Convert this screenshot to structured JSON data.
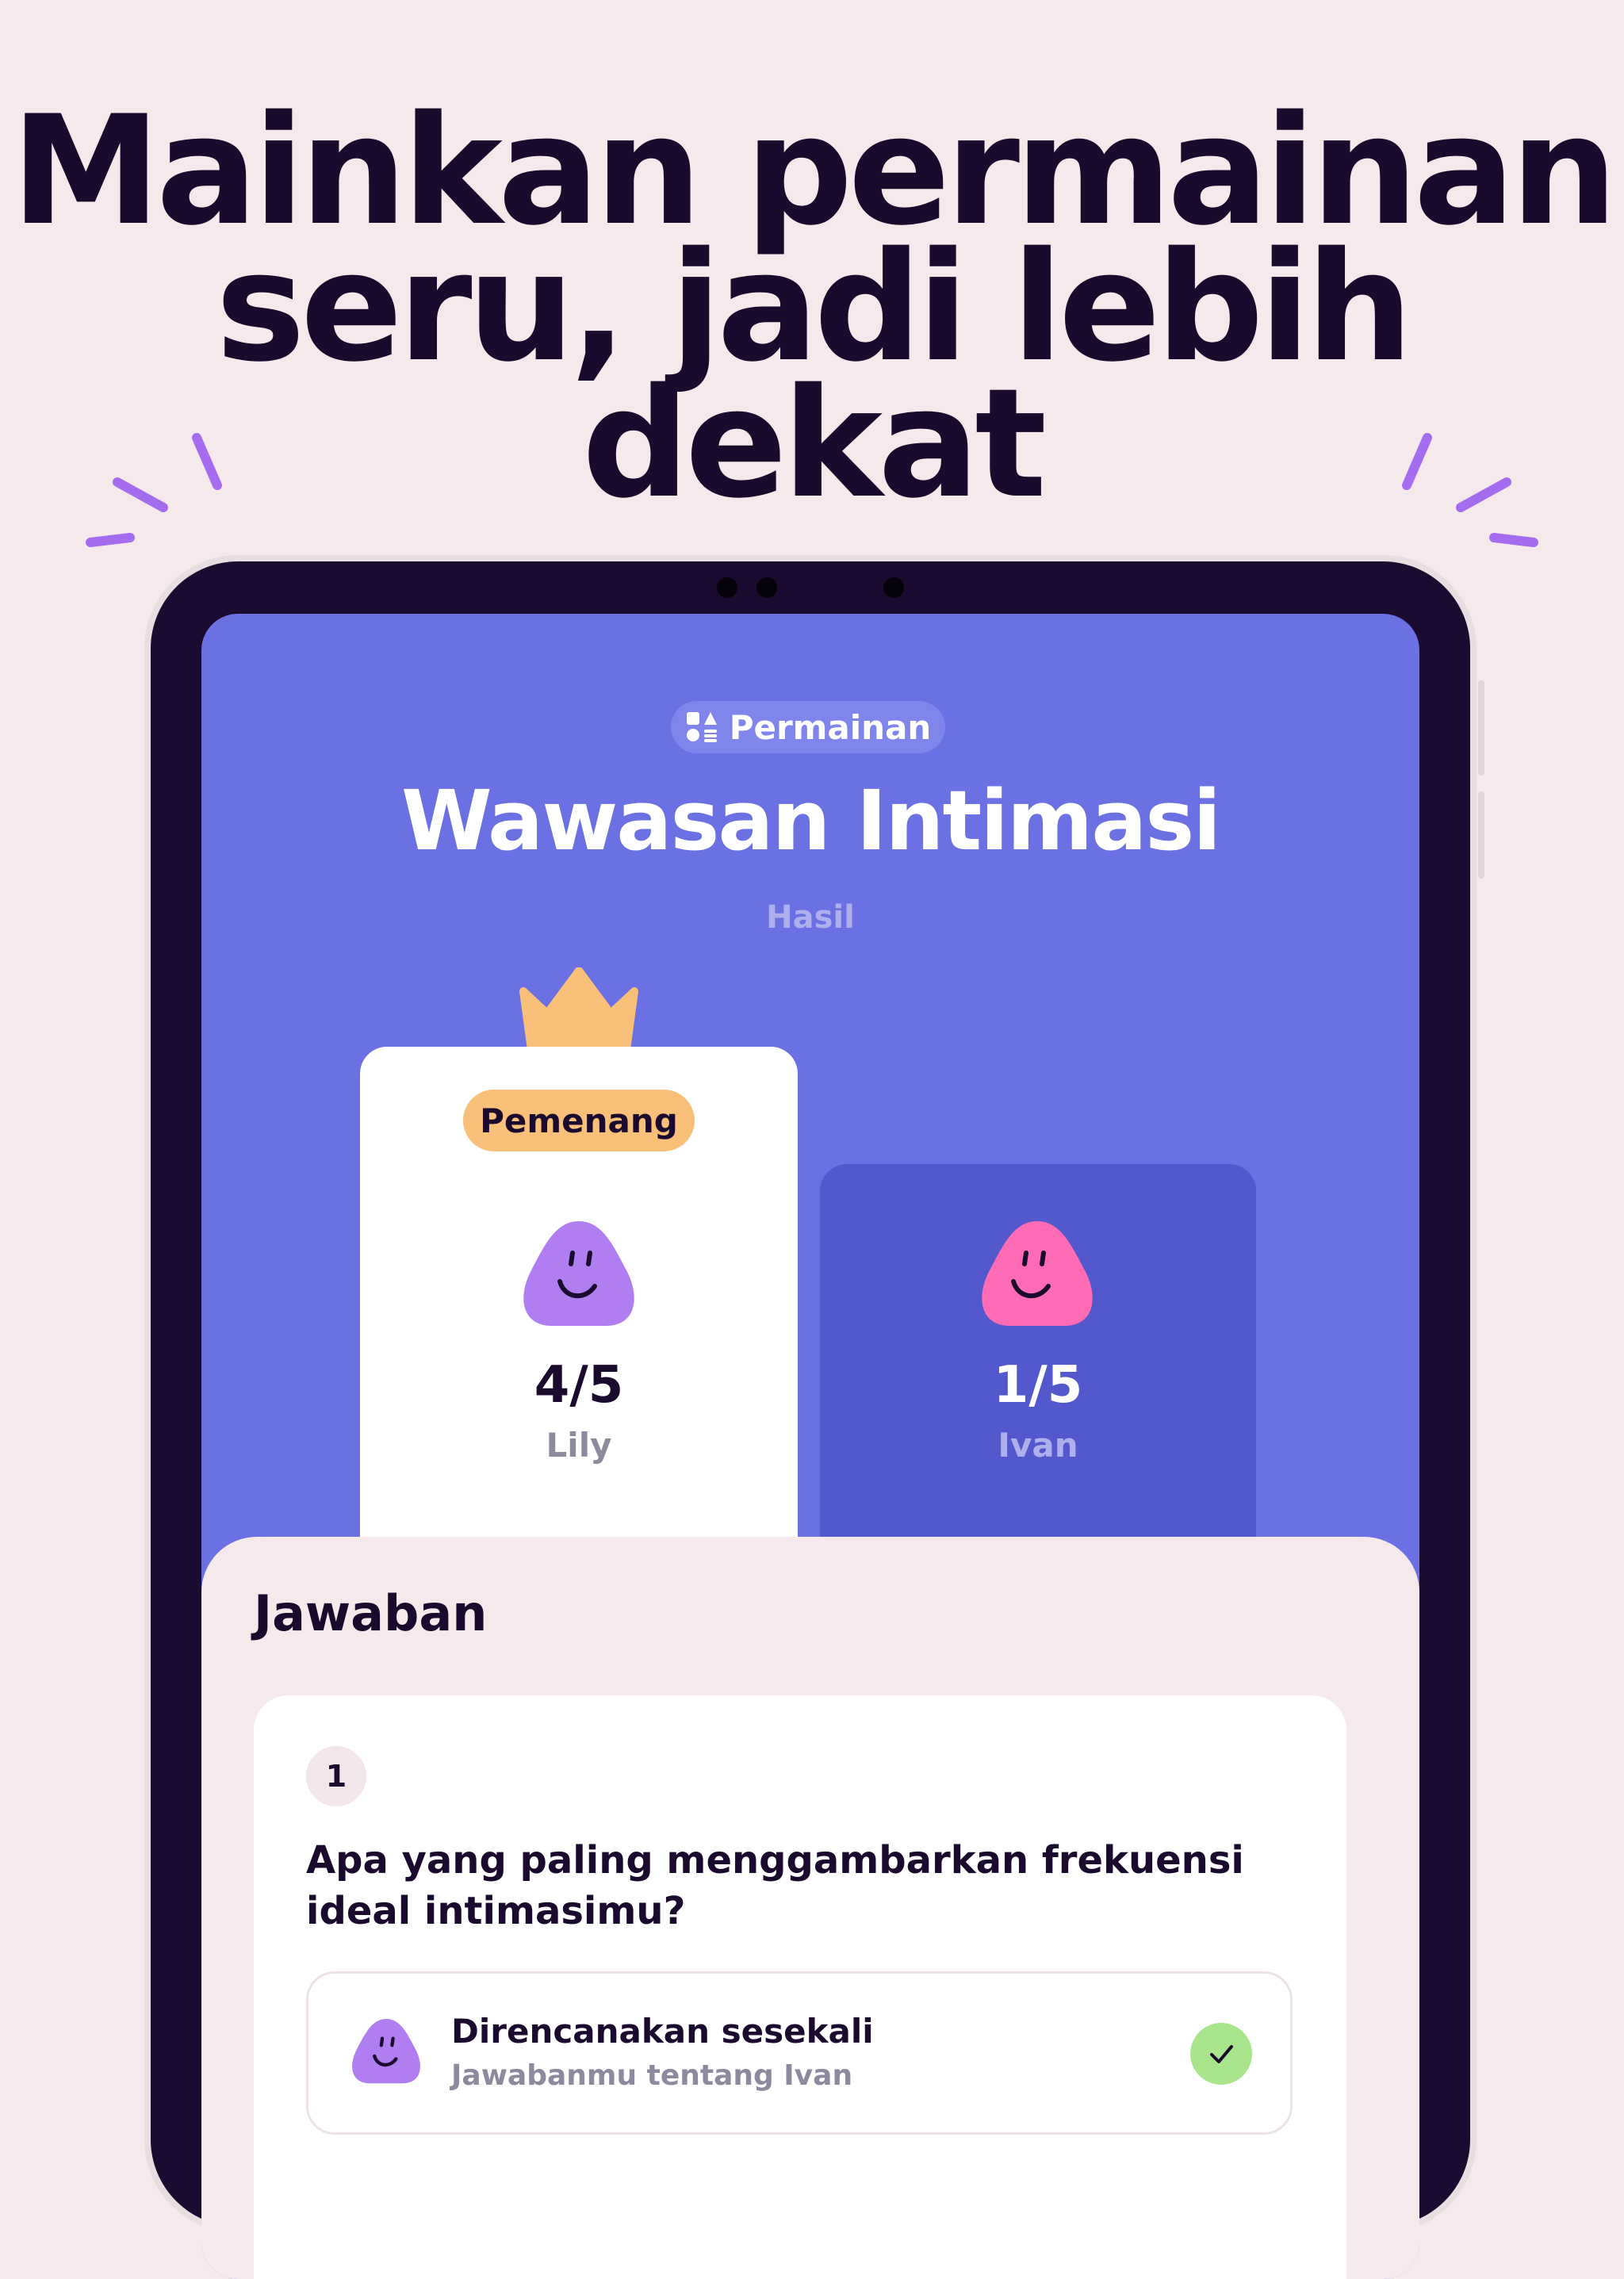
{
  "headline": {
    "line1": "Mainkan permainan",
    "line2": "seru, jadi lebih dekat"
  },
  "screen": {
    "category_label": "Permainan",
    "category_icon": "shapes-icon",
    "game_title": "Wawasan Intimasi",
    "results_label": "Hasil",
    "winner": {
      "badge": "Pemenang",
      "score": "4/5",
      "name": "Lily",
      "avatar_color": "#b07ef0",
      "icon": "crown-icon"
    },
    "other": {
      "score": "1/5",
      "name": "Ivan",
      "avatar_color": "#ff6bb5"
    },
    "answers": {
      "title": "Jawaban",
      "question_number": "1",
      "question": "Apa yang paling menggambarkan frekuensi ideal intimasimu?",
      "answer_text": "Direncanakan sesekali",
      "answer_sub": "Jawabanmu tentang Ivan",
      "answer_status_icon": "check-icon"
    }
  },
  "colors": {
    "background": "#f5e9ec",
    "ink": "#1a0a2e",
    "screen": "#6b70e2",
    "winner_badge": "#f9c07a",
    "sparkle": "#a66cf0",
    "check": "#a8e58c"
  }
}
